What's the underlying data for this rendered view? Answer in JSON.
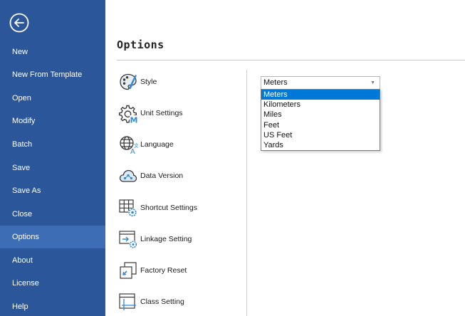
{
  "sidebar": {
    "back_icon": "back-arrow-circle-icon",
    "items": [
      {
        "label": "New"
      },
      {
        "label": "New From Template"
      },
      {
        "label": "Open"
      },
      {
        "label": "Modify"
      },
      {
        "label": "Batch"
      },
      {
        "label": "Save"
      },
      {
        "label": "Save As"
      },
      {
        "label": "Close"
      },
      {
        "label": "Options",
        "active": true
      },
      {
        "label": "About"
      },
      {
        "label": "License"
      },
      {
        "label": "Help"
      }
    ],
    "background": "#2b579a",
    "active_background": "#3d6db5"
  },
  "main": {
    "title": "Options",
    "categories": [
      {
        "label": "Style",
        "icon": "palette-icon"
      },
      {
        "label": "Unit Settings",
        "icon": "gear-m-icon"
      },
      {
        "label": "Language",
        "icon": "globe-icon"
      },
      {
        "label": "Data Version",
        "icon": "cloud-icon"
      },
      {
        "label": "Shortcut Settings",
        "icon": "keyboard-gear-icon"
      },
      {
        "label": "Linkage Setting",
        "icon": "window-link-icon"
      },
      {
        "label": "Factory Reset",
        "icon": "reset-icon"
      },
      {
        "label": "Class Setting",
        "icon": "window-grid-icon"
      }
    ]
  },
  "unit_select": {
    "selected": "Meters",
    "options": [
      "Meters",
      "Kilometers",
      "Miles",
      "Feet",
      "US Feet",
      "Yards"
    ],
    "highlighted": "Meters",
    "highlight_color": "#0078d7"
  }
}
